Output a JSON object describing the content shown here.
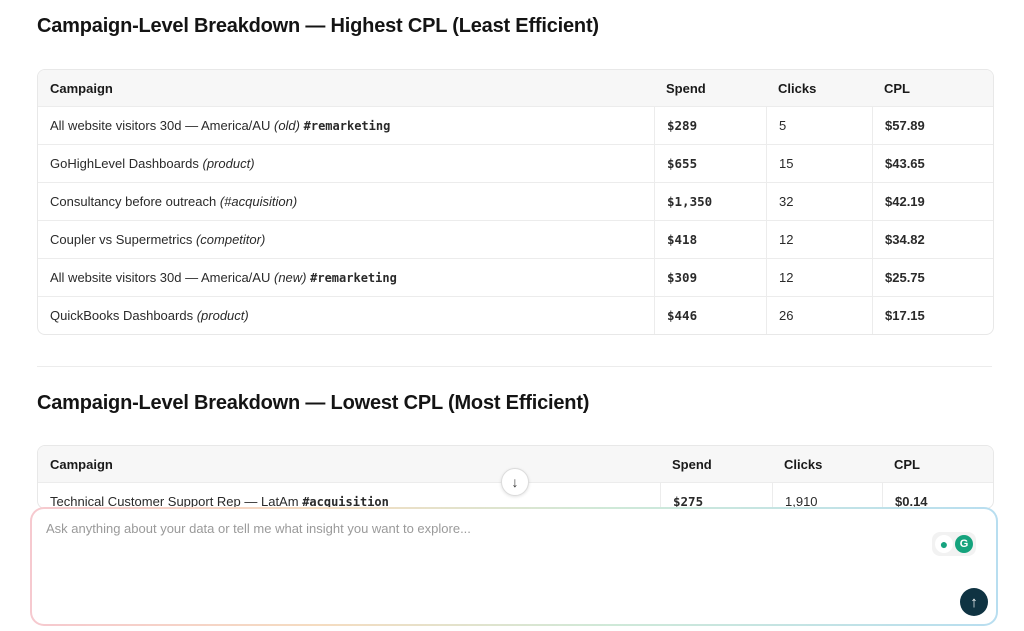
{
  "section1": {
    "title": "Campaign-Level Breakdown — Highest CPL (Least Efficient)",
    "headers": [
      "Campaign",
      "Spend",
      "Clicks",
      "CPL"
    ],
    "rows": [
      {
        "name": "All website visitors 30d — America/AU",
        "note": "(old)",
        "tag": "#remarketing",
        "spend": "$289",
        "clicks": "5",
        "cpl": "$57.89"
      },
      {
        "name": "GoHighLevel Dashboards",
        "note": "(product)",
        "tag": "",
        "spend": "$655",
        "clicks": "15",
        "cpl": "$43.65"
      },
      {
        "name": "Consultancy before outreach",
        "note": "(#acquisition)",
        "tag": "",
        "spend": "$1,350",
        "clicks": "32",
        "cpl": "$42.19"
      },
      {
        "name": "Coupler vs Supermetrics",
        "note": "(competitor)",
        "tag": "",
        "spend": "$418",
        "clicks": "12",
        "cpl": "$34.82"
      },
      {
        "name": "All website visitors 30d — America/AU",
        "note": "(new)",
        "tag": "#remarketing",
        "spend": "$309",
        "clicks": "12",
        "cpl": "$25.75"
      },
      {
        "name": "QuickBooks Dashboards",
        "note": "(product)",
        "tag": "",
        "spend": "$446",
        "clicks": "26",
        "cpl": "$17.15"
      }
    ]
  },
  "section2": {
    "title": "Campaign-Level Breakdown — Lowest CPL (Most Efficient)",
    "headers": [
      "Campaign",
      "Spend",
      "Clicks",
      "CPL"
    ],
    "rows": [
      {
        "name": "Technical Customer Support Rep — LatAm",
        "note": "",
        "tag": "#acquisition",
        "spend": "$275",
        "clicks": "1,910",
        "cpl": "$0.14"
      }
    ]
  },
  "composer": {
    "placeholder": "Ask anything about your data or tell me what insight you want to explore...",
    "scroll_icon": "arrow-down-icon",
    "send_icon": "arrow-up-icon"
  }
}
